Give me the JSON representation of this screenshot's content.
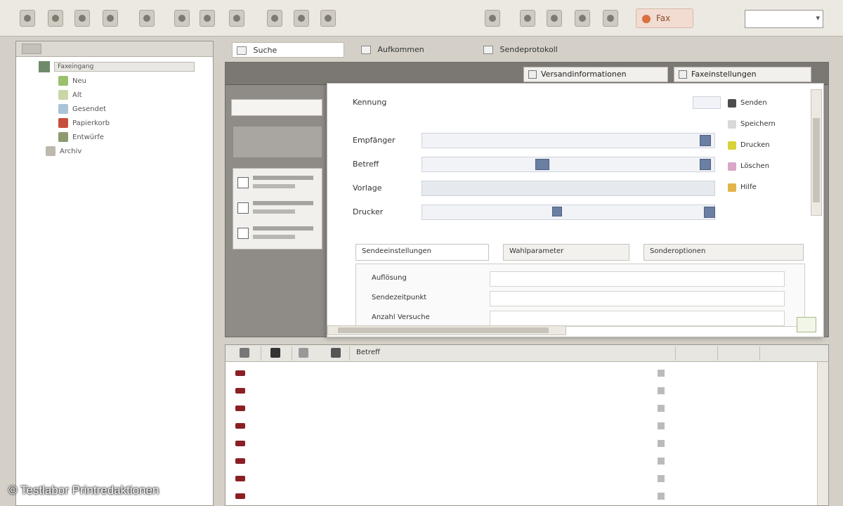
{
  "toolbar": {
    "red_button_label": "Fax",
    "combo_value": ""
  },
  "tabs": [
    {
      "label": "Suche"
    },
    {
      "label": "Aufkommen"
    },
    {
      "label": "Sendeprotokoll"
    }
  ],
  "header_buttons": [
    {
      "label": "Versandinformationen"
    },
    {
      "label": "Faxeinstellungen"
    }
  ],
  "tree": {
    "root_label": "Faxeingang",
    "items": [
      {
        "label": "Neu"
      },
      {
        "label": "Alt"
      },
      {
        "label": "Gesendet"
      },
      {
        "label": "Papierkorb"
      },
      {
        "label": "Entwürfe"
      },
      {
        "label": "Archiv"
      }
    ]
  },
  "dialog": {
    "rows": [
      {
        "label": "Kennung",
        "value": ""
      },
      {
        "label": "Empfänger",
        "value": ""
      },
      {
        "label": "Betreff",
        "value": ""
      },
      {
        "label": "Vorlage",
        "value": ""
      },
      {
        "label": "Drucker",
        "value": ""
      }
    ],
    "side_buttons": [
      {
        "label": "Senden"
      },
      {
        "label": "Speichern"
      },
      {
        "label": "Drucken"
      },
      {
        "label": "Löschen"
      },
      {
        "label": "Hilfe"
      }
    ],
    "subtabs": [
      {
        "label": "Sendeeinstellungen"
      },
      {
        "label": "Wahlparameter"
      },
      {
        "label": "Sonderoptionen"
      }
    ],
    "sub_rows": [
      {
        "label": "Auflösung",
        "value": ""
      },
      {
        "label": "Sendezeitpunkt",
        "value": ""
      },
      {
        "label": "Anzahl Versuche",
        "value": ""
      }
    ]
  },
  "list": {
    "headers": [
      {
        "label": "Betreff"
      }
    ],
    "rows": [
      {
        "subject": "",
        "c2": "",
        "c3": ""
      },
      {
        "subject": "",
        "c2": "",
        "c3": ""
      },
      {
        "subject": "",
        "c2": "",
        "c3": ""
      },
      {
        "subject": "",
        "c2": "",
        "c3": ""
      },
      {
        "subject": "",
        "c2": "",
        "c3": ""
      },
      {
        "subject": "",
        "c2": "",
        "c3": ""
      },
      {
        "subject": "",
        "c2": "",
        "c3": ""
      },
      {
        "subject": "",
        "c2": "",
        "c3": ""
      }
    ]
  },
  "watermark": "© Testlabor Printredaktionen",
  "colors": {
    "envelope": "#8a1f26",
    "panel_grey": "#8f8c88",
    "field_blue": "#f1f3f7"
  }
}
